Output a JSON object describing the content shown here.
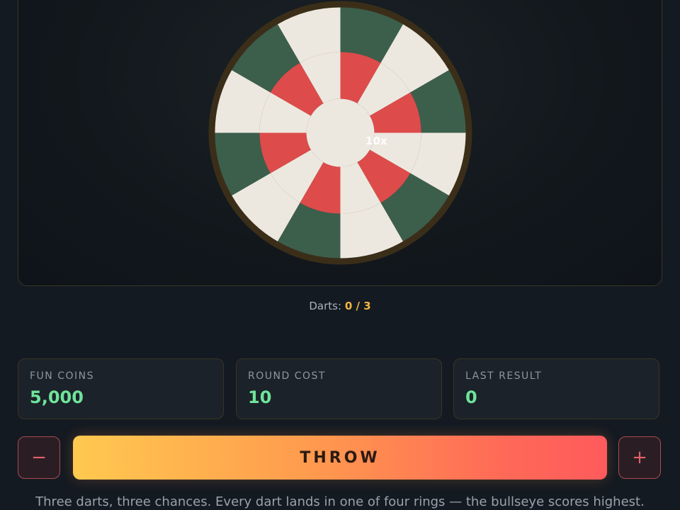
{
  "board": {
    "multiplier_label": "10x"
  },
  "darts": {
    "label": "Darts:",
    "count": "0 / 3"
  },
  "stats": [
    {
      "label": "FUN COINS",
      "value": "5,000"
    },
    {
      "label": "ROUND COST",
      "value": "10"
    },
    {
      "label": "LAST RESULT",
      "value": "0"
    }
  ],
  "controls": {
    "decrease_label": "−",
    "throw_label": "THROW",
    "increase_label": "+"
  },
  "help_text": "Three darts, three chances. Every dart lands in one of four rings — the bullseye scores highest.",
  "colors": {
    "green": "#3c5f4c",
    "cream": "#ede8df",
    "red": "#dd4b4b",
    "rim": "#3b2e19",
    "accent_gold": "#f3b53f",
    "value_green": "#6fe39a"
  }
}
